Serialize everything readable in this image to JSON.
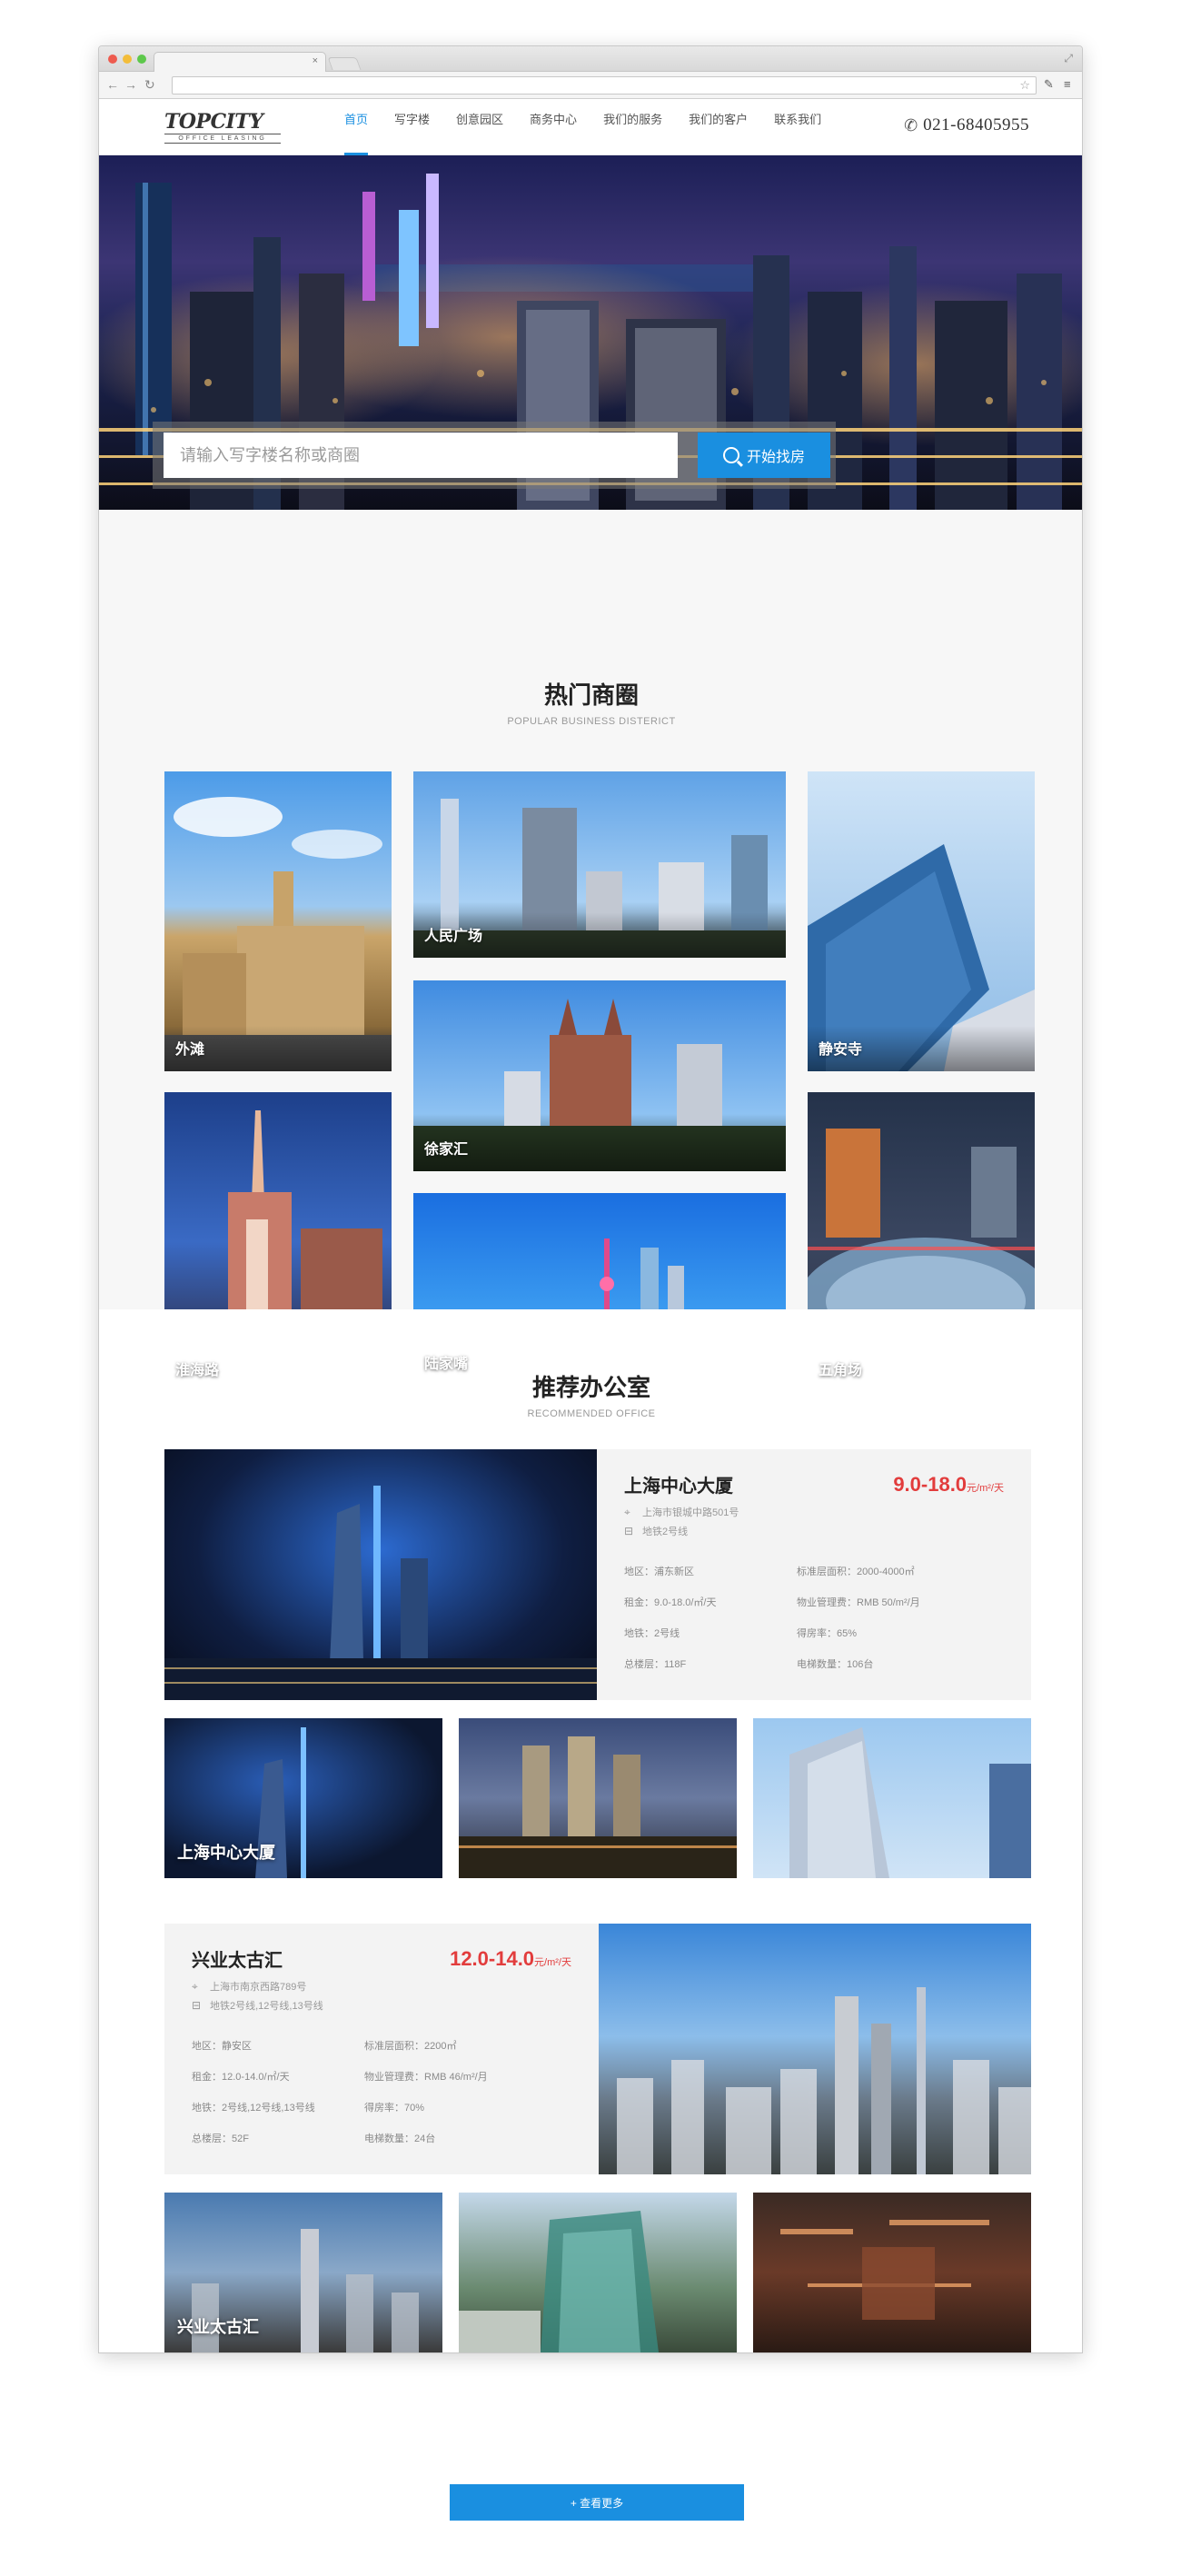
{
  "browser": {
    "tab_close": "×",
    "nav_back": "←",
    "nav_forward": "→",
    "reload": "↻",
    "star": "☆",
    "wrench": "✎",
    "menu": "≡",
    "expand": "⤢"
  },
  "header": {
    "logo_main": "TOPCITY",
    "logo_sub": "OFFICE LEASING",
    "menu": [
      {
        "label": "首页",
        "active": true
      },
      {
        "label": "写字楼"
      },
      {
        "label": "创意园区"
      },
      {
        "label": "商务中心"
      },
      {
        "label": "我们的服务"
      },
      {
        "label": "我们的客户"
      },
      {
        "label": "联系我们"
      }
    ],
    "phone_icon": "✆",
    "phone": "021-68405955"
  },
  "search": {
    "placeholder": "请输入写字楼名称或商圈",
    "button": "开始找房"
  },
  "hot": {
    "title": "热门商圈",
    "subtitle": "POPULAR BUSINESS DISTERICT",
    "areas": [
      "外滩",
      "人民广场",
      "静安寺",
      "徐家汇",
      "淮海路",
      "陆家嘴",
      "五角场"
    ]
  },
  "recommended": {
    "title": "推荐办公室",
    "subtitle": "RECOMMENDED OFFICE",
    "offices": [
      {
        "name": "上海中心大厦",
        "price": "9.0-18.0",
        "unit": "元/m²/天",
        "address": "上海市银城中路501号",
        "metro": "地铁2号线",
        "specs": [
          "地区：浦东新区",
          "标准层面积：2000-4000㎡",
          "租金：9.0-18.0/㎡/天",
          "物业管理费：RMB 50/m²/月",
          "地铁：2号线",
          "得房率：65%",
          "总楼层：118F",
          "电梯数量：106台"
        ],
        "thumb_label": "上海中心大厦"
      },
      {
        "name": "兴业太古汇",
        "price": "12.0-14.0",
        "unit": "元/m²/天",
        "address": "上海市南京西路789号",
        "metro": "地铁2号线,12号线,13号线",
        "specs": [
          "地区：静安区",
          "标准层面积：2200㎡",
          "租金：12.0-14.0/㎡/天",
          "物业管理费：RMB 46/m²/月",
          "地铁：2号线,12号线,13号线",
          "得房率：70%",
          "总楼层：52F",
          "电梯数量：24台"
        ],
        "thumb_label": "兴业太古汇"
      }
    ],
    "more_button": "+ 查看更多"
  },
  "colors": {
    "accent": "#1a8fe0",
    "price": "#e23c3c"
  }
}
